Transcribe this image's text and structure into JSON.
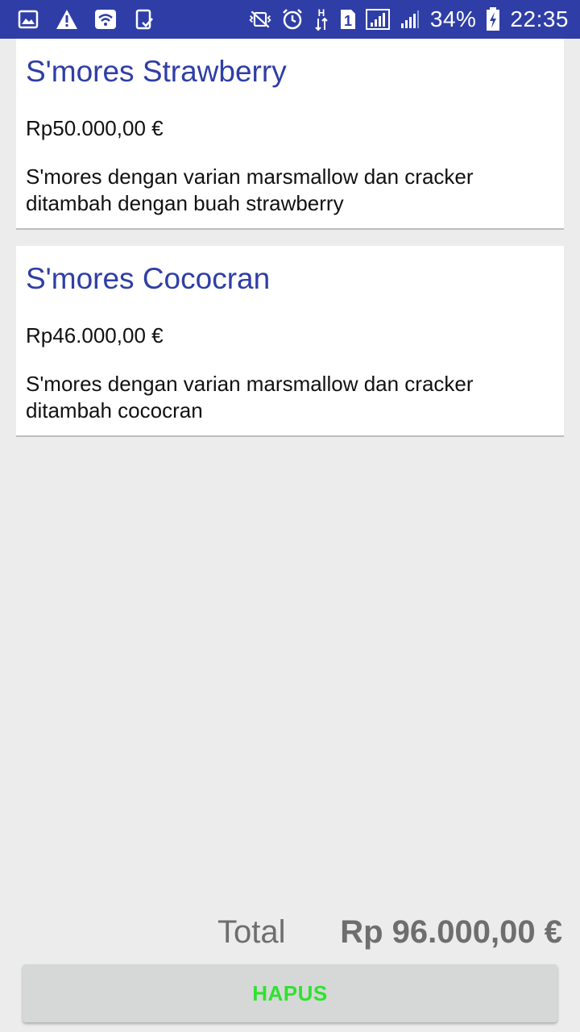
{
  "status_bar": {
    "battery_percent": "34%",
    "time": "22:35",
    "network_type": "H",
    "sim_slot": "1",
    "icons": [
      "image-icon",
      "warning-icon",
      "wifi-icon",
      "clipboard-check-icon",
      "vibrate-mute-icon",
      "alarm-icon",
      "data-arrows-icon",
      "sim-icon",
      "signal-icon",
      "signal-icon-2",
      "battery-charging-icon"
    ]
  },
  "cart": {
    "items": [
      {
        "title": "S'mores Strawberry",
        "price": "Rp50.000,00 €",
        "description": "S'mores dengan varian marsmallow dan cracker ditambah dengan buah strawberry"
      },
      {
        "title": "S'mores Cococran",
        "price": "Rp46.000,00 €",
        "description": "S'mores dengan varian marsmallow dan cracker ditambah cococran"
      }
    ]
  },
  "footer": {
    "total_label": "Total",
    "total_value": "Rp 96.000,00 €",
    "hapus_label": "HAPUS"
  },
  "colors": {
    "status_bar": "#2f3ea6",
    "title_text": "#2f3ea6",
    "hapus_text": "#2ee32e",
    "background": "#ececec"
  }
}
